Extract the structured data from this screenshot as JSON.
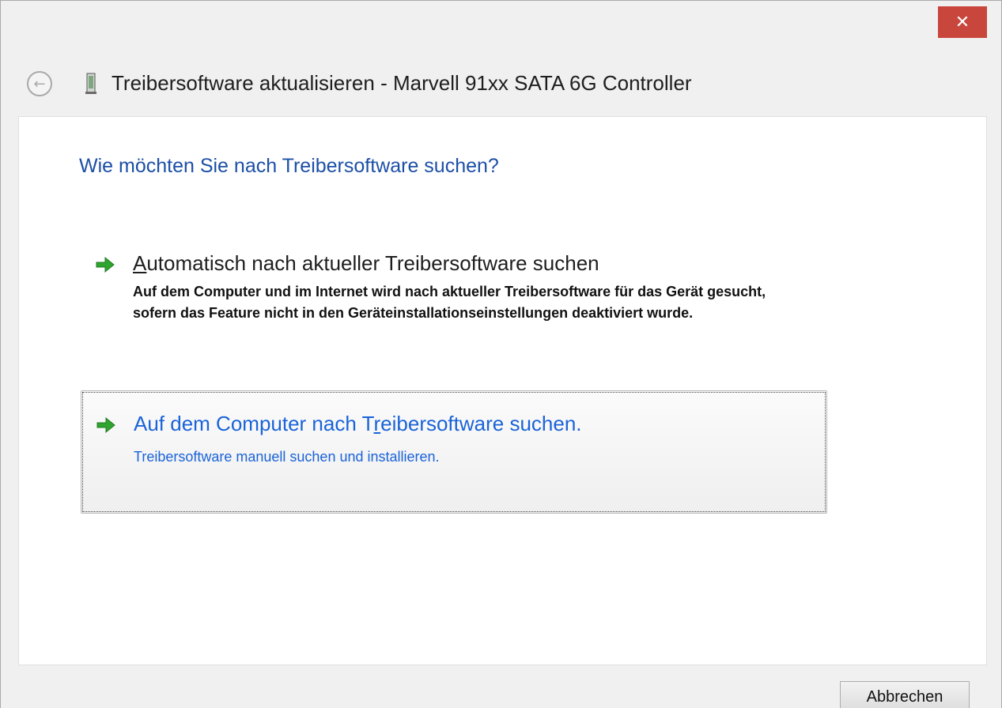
{
  "window": {
    "close_label": "✕",
    "back_label": "←",
    "title": "Treibersoftware aktualisieren - Marvell 91xx SATA 6G Controller",
    "icons": {
      "back": "back-arrow-icon",
      "device": "device-icon",
      "close": "close-icon",
      "option": "green-arrow-icon"
    }
  },
  "main": {
    "question": "Wie möchten Sie nach Treibersoftware suchen?",
    "options": [
      {
        "title_accel": "A",
        "title_rest": "utomatisch nach aktueller Treibersoftware suchen",
        "description": "Auf dem Computer und im Internet wird nach aktueller Treibersoftware für das Gerät gesucht, sofern das Feature nicht in den Geräteinstallationseinstellungen deaktiviert wurde."
      },
      {
        "title_pre": "Auf dem Computer nach T",
        "title_accel": "r",
        "title_post": "eibersoftware suchen.",
        "description": "Treibersoftware manuell suchen und installieren."
      }
    ]
  },
  "footer": {
    "cancel_label": "Abbrechen"
  },
  "colors": {
    "close_bg": "#c9463d",
    "question": "#1c4fa6",
    "link": "#1a63d8",
    "arrow_green": "#2fa52f"
  }
}
